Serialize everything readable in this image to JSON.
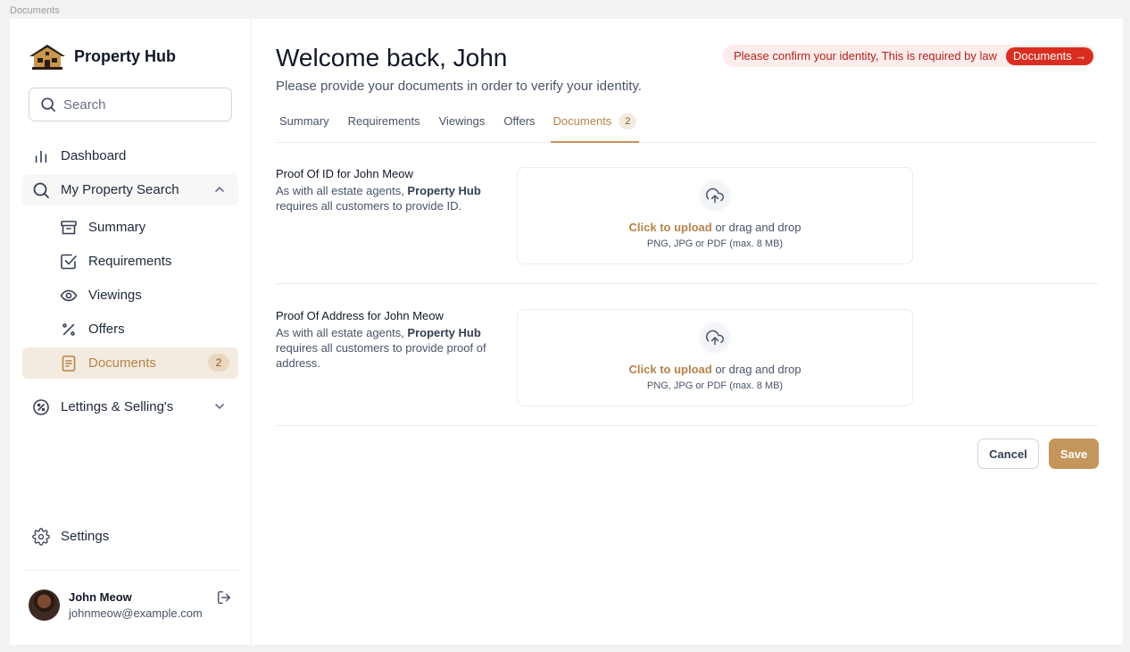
{
  "frame_label": "Documents",
  "brand": {
    "name": "Property Hub",
    "logo_icon": "house-logo-icon"
  },
  "search": {
    "placeholder": "Search"
  },
  "nav": {
    "dashboard": "Dashboard",
    "my_property_search": "My Property Search",
    "sub_items": [
      {
        "label": "Summary",
        "icon": "archive-icon"
      },
      {
        "label": "Requirements",
        "icon": "checkbox-icon"
      },
      {
        "label": "Viewings",
        "icon": "eye-icon"
      },
      {
        "label": "Offers",
        "icon": "percent-icon"
      },
      {
        "label": "Documents",
        "icon": "document-icon",
        "badge": "2"
      }
    ],
    "lettings": "Lettings & Selling's",
    "settings": "Settings"
  },
  "user": {
    "name": "John Meow",
    "email": "johnmeow@example.com"
  },
  "header": {
    "title": "Welcome back, John",
    "subtitle": "Please provide your documents in order to verify your identity."
  },
  "alert": {
    "message": "Please confirm your identity, This is required by law",
    "button": "Documents →"
  },
  "tabs": [
    {
      "label": "Summary"
    },
    {
      "label": "Requirements"
    },
    {
      "label": "Viewings"
    },
    {
      "label": "Offers"
    },
    {
      "label": "Documents",
      "badge": "2"
    }
  ],
  "sections": [
    {
      "title": "Proof Of ID for John Meow",
      "desc_pre": "As with all estate agents, ",
      "desc_brand": "Property Hub",
      "desc_post": " requires all customers to provide ID."
    },
    {
      "title": "Proof Of Address for John Meow",
      "desc_pre": "As with all estate agents, ",
      "desc_brand": "Property Hub",
      "desc_post": " requires all customers to provide proof of address."
    }
  ],
  "upload": {
    "link": "Click to upload",
    "rest": " or drag and drop",
    "hint": "PNG, JPG or PDF (max. 8 MB)"
  },
  "actions": {
    "cancel": "Cancel",
    "save": "Save"
  },
  "colors": {
    "accent": "#c4965c",
    "alert": "#d92d20",
    "active_bg": "#f4ebe0"
  }
}
